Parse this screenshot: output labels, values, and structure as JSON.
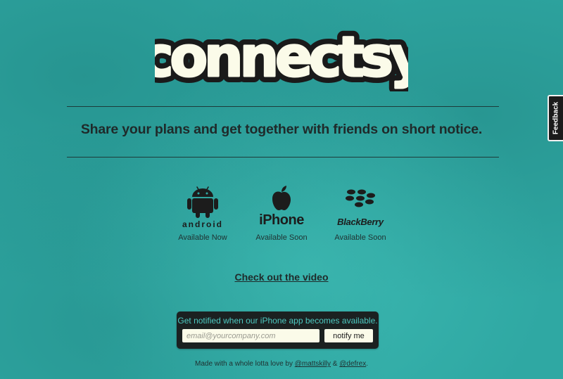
{
  "logo": {
    "text": "connectsy"
  },
  "tagline": "Share your plans and get together with friends on short notice.",
  "platforms": [
    {
      "name": "android",
      "status": "Available Now",
      "icon": "android-robot-icon"
    },
    {
      "name": "iPhone",
      "status": "Available Soon",
      "icon": "apple-icon"
    },
    {
      "name": "BlackBerry",
      "status": "Available Soon",
      "icon": "blackberry-icon"
    }
  ],
  "video_link": "Check out the video",
  "notify": {
    "text": "Get notified when our iPhone app becomes available.",
    "email_placeholder": "email@yourcompany.com",
    "button_label": "notify me"
  },
  "footer": {
    "prefix": "Made with a whole lotta love by ",
    "link1": "@mattskilly",
    "separator": " & ",
    "link2": "@defrex",
    "suffix": "."
  },
  "feedback_tab": "Feedback",
  "colors": {
    "background": "#2fa8a3",
    "logo_fill": "#fbfbe9",
    "logo_outline": "#1a1a1a",
    "notify_bg": "#1b2121",
    "notify_text": "#4dc9c1"
  }
}
